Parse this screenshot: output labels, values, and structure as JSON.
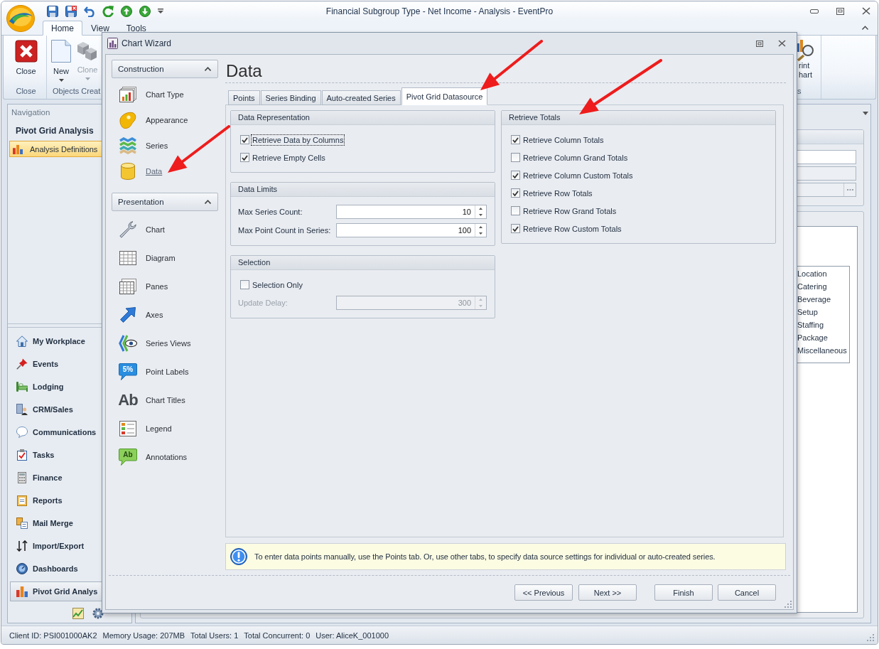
{
  "window": {
    "title": "Financial Subgroup Type - Net Income - Analysis - EventPro"
  },
  "ribbon": {
    "tabs": [
      {
        "label": "Home",
        "selected": true
      },
      {
        "label": "View",
        "selected": false
      },
      {
        "label": "Tools",
        "selected": false
      }
    ],
    "groups": [
      {
        "label": "Close",
        "buttons": [
          {
            "label": "Close",
            "disabled": false,
            "dropdown": false
          }
        ]
      },
      {
        "label": "Objects Creat",
        "buttons": [
          {
            "label": "New",
            "disabled": false,
            "dropdown": true
          },
          {
            "label": "Clone",
            "disabled": true,
            "dropdown": true
          }
        ]
      }
    ],
    "partial_group": {
      "label": "s",
      "button_lines": [
        "rint",
        "hart"
      ]
    }
  },
  "navigation": {
    "title": "Navigation",
    "section": "Pivot Grid Analysis",
    "items": [
      {
        "label": "Analysis Definitions",
        "selected": true
      }
    ],
    "modules": [
      {
        "label": "My Workplace",
        "selected": false
      },
      {
        "label": "Events",
        "selected": false
      },
      {
        "label": "Lodging",
        "selected": false
      },
      {
        "label": "CRM/Sales",
        "selected": false
      },
      {
        "label": "Communications",
        "selected": false
      },
      {
        "label": "Tasks",
        "selected": false
      },
      {
        "label": "Finance",
        "selected": false
      },
      {
        "label": "Reports",
        "selected": false
      },
      {
        "label": "Mail Merge",
        "selected": false
      },
      {
        "label": "Import/Export",
        "selected": false
      },
      {
        "label": "Dashboards",
        "selected": false
      },
      {
        "label": "Pivot Grid Analys",
        "selected": true
      }
    ]
  },
  "workspace": {
    "fields": [
      {
        "kind": "text",
        "disabled": false
      },
      {
        "kind": "text",
        "disabled": true
      },
      {
        "kind": "browse",
        "disabled": true
      }
    ],
    "list_items": [
      "Location",
      "Catering",
      "Beverage",
      "Setup",
      "Staffing",
      "Package",
      "Miscellaneous"
    ]
  },
  "dialog": {
    "title": "Chart Wizard",
    "sections": [
      {
        "title": "Construction",
        "expanded": true,
        "items": [
          {
            "label": "Chart Type",
            "selected": false
          },
          {
            "label": "Appearance",
            "selected": false
          },
          {
            "label": "Series",
            "selected": false
          },
          {
            "label": "Data",
            "selected": true
          }
        ]
      },
      {
        "title": "Presentation",
        "expanded": true,
        "items": [
          {
            "label": "Chart",
            "selected": false
          },
          {
            "label": "Diagram",
            "selected": false
          },
          {
            "label": "Panes",
            "selected": false
          },
          {
            "label": "Axes",
            "selected": false
          },
          {
            "label": "Series Views",
            "selected": false
          },
          {
            "label": "Point Labels",
            "selected": false,
            "icon_text": "5%"
          },
          {
            "label": "Chart Titles",
            "selected": false,
            "icon_text": "Ab"
          },
          {
            "label": "Legend",
            "selected": false
          },
          {
            "label": "Annotations",
            "selected": false,
            "icon_text": "Ab"
          }
        ]
      }
    ],
    "page_title": "Data",
    "tabs": [
      {
        "label": "Points",
        "selected": false
      },
      {
        "label": "Series Binding",
        "selected": false
      },
      {
        "label": "Auto-created Series",
        "selected": false
      },
      {
        "label": "Pivot Grid Datasource",
        "selected": true
      }
    ],
    "columns": [
      {
        "groups": [
          {
            "title": "Data Representation",
            "rows": [
              {
                "kind": "checkbox",
                "label": "Retrieve Data by Columns",
                "checked": true,
                "focused": true
              },
              {
                "kind": "checkbox",
                "label": "Retrieve Empty Cells",
                "checked": true,
                "focused": false
              }
            ]
          },
          {
            "title": "Data Limits",
            "rows": [
              {
                "kind": "spin",
                "label": "Max Series Count:",
                "value": "10",
                "disabled": false
              },
              {
                "kind": "spin",
                "label": "Max Point Count in Series:",
                "value": "100",
                "disabled": false
              }
            ]
          },
          {
            "title": "Selection",
            "rows": [
              {
                "kind": "checkbox",
                "label": "Selection Only",
                "checked": false,
                "focused": false
              },
              {
                "kind": "spin",
                "label": "Update Delay:",
                "value": "300",
                "disabled": true
              }
            ]
          }
        ]
      },
      {
        "groups": [
          {
            "title": "Retrieve Totals",
            "rows": [
              {
                "kind": "checkbox",
                "label": "Retrieve Column Totals",
                "checked": true,
                "focused": false
              },
              {
                "kind": "checkbox",
                "label": "Retrieve Column Grand Totals",
                "checked": false,
                "focused": false
              },
              {
                "kind": "checkbox",
                "label": "Retrieve Column Custom Totals",
                "checked": true,
                "focused": false
              },
              {
                "kind": "checkbox",
                "label": "Retrieve Row Totals",
                "checked": true,
                "focused": false
              },
              {
                "kind": "checkbox",
                "label": "Retrieve Row Grand Totals",
                "checked": false,
                "focused": false
              },
              {
                "kind": "checkbox",
                "label": "Retrieve Row Custom Totals",
                "checked": true,
                "focused": false
              }
            ]
          }
        ]
      }
    ],
    "info": "To enter data points manually, use the Points tab. Or, use other tabs, to specify data source settings for individual or auto-created series.",
    "buttons": [
      {
        "label": "<< Previous",
        "kind": "nav"
      },
      {
        "label": "Next >>",
        "kind": "nav"
      },
      {
        "label": "Finish",
        "kind": "action"
      },
      {
        "label": "Cancel",
        "kind": "action"
      }
    ]
  },
  "status_bar": [
    "Client ID: PSI001000AK2",
    "Memory Usage: 207MB",
    "Total Users: 1",
    "Total Concurrent: 0",
    "User: AliceK_001000"
  ]
}
